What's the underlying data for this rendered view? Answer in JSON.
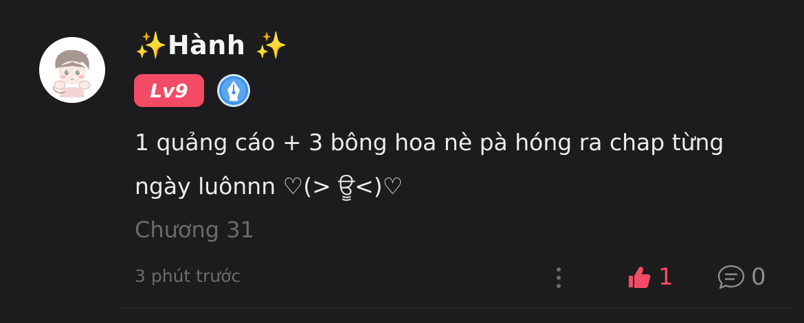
{
  "comment": {
    "author": {
      "sparkle_left": "✨",
      "name": "Hành",
      "sparkle_right": "✨"
    },
    "level_badge": "Lv9",
    "writer_badge_icon": "pen-nib-icon",
    "content": "1 quảng cáo + 3 bông hoa nè pà hóng ra chap từng ngày luônnn ♡(> ਊ<)♡",
    "chapter": "Chương 31",
    "time": "3 phút trước",
    "likes": "1",
    "replies": "0"
  },
  "colors": {
    "background": "#1c1b1d",
    "level_badge": "#f34a66",
    "like_active": "#f34a66",
    "muted_text": "#6b6a6d",
    "writer_badge": "#3a8ee6"
  }
}
